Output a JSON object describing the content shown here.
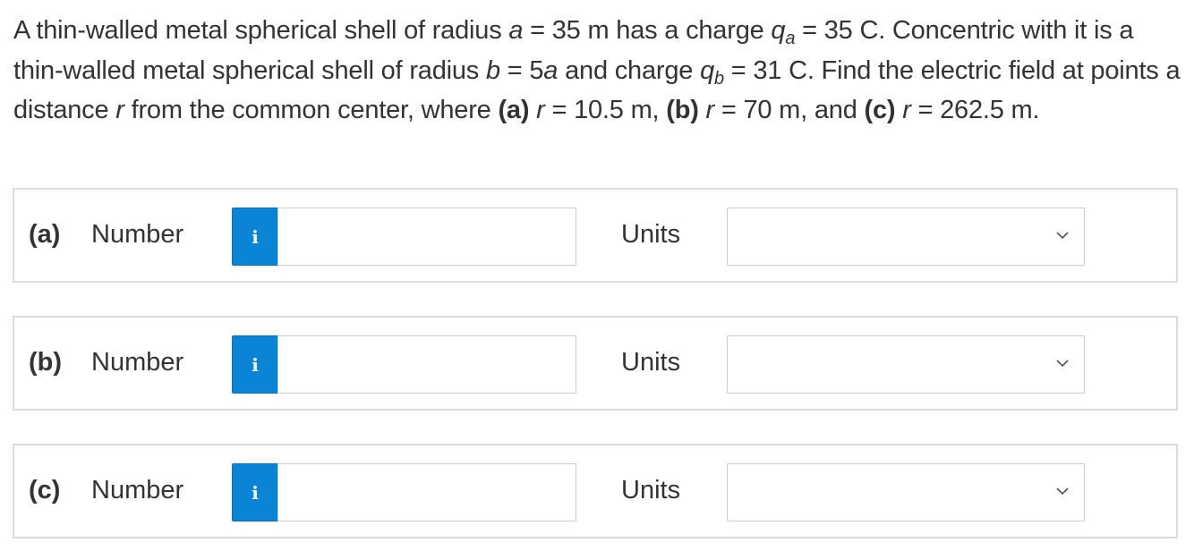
{
  "question": {
    "part1": "A thin-walled metal spherical shell of radius ",
    "var_a": "a",
    "part2": " = 35 m has a charge ",
    "var_q": "q",
    "sub_a": "a",
    "part3": " = 35 C. Concentric with it is a thin-walled metal spherical shell of radius ",
    "var_b": "b",
    "part4": " = 5",
    "var_a2": "a",
    "part5": " and charge ",
    "var_q2": "q",
    "sub_b": "b",
    "part6": " = 31 C. Find the electric field at points a distance ",
    "var_r": "r",
    "part7": " from the common center, where ",
    "label_a": "(a)",
    "var_r_a": "r",
    "part8": " = 10.5 m, ",
    "label_b": "(b)",
    "var_r_b": "r",
    "part9": " = 70 m, and ",
    "label_c": "(c)",
    "var_r_c": "r",
    "part10": " = 262.5 m."
  },
  "rows": [
    {
      "part": "(a)",
      "number_label": "Number",
      "info": "i",
      "value": "",
      "units_label": "Units",
      "units_value": ""
    },
    {
      "part": "(b)",
      "number_label": "Number",
      "info": "i",
      "value": "",
      "units_label": "Units",
      "units_value": ""
    },
    {
      "part": "(c)",
      "number_label": "Number",
      "info": "i",
      "value": "",
      "units_label": "Units",
      "units_value": ""
    }
  ],
  "icons": {
    "info": "info-icon",
    "dropdown": "chevron-down-icon"
  },
  "colors": {
    "info_button": "#0c84d6",
    "border": "#dcdcdc",
    "text": "#333333"
  }
}
